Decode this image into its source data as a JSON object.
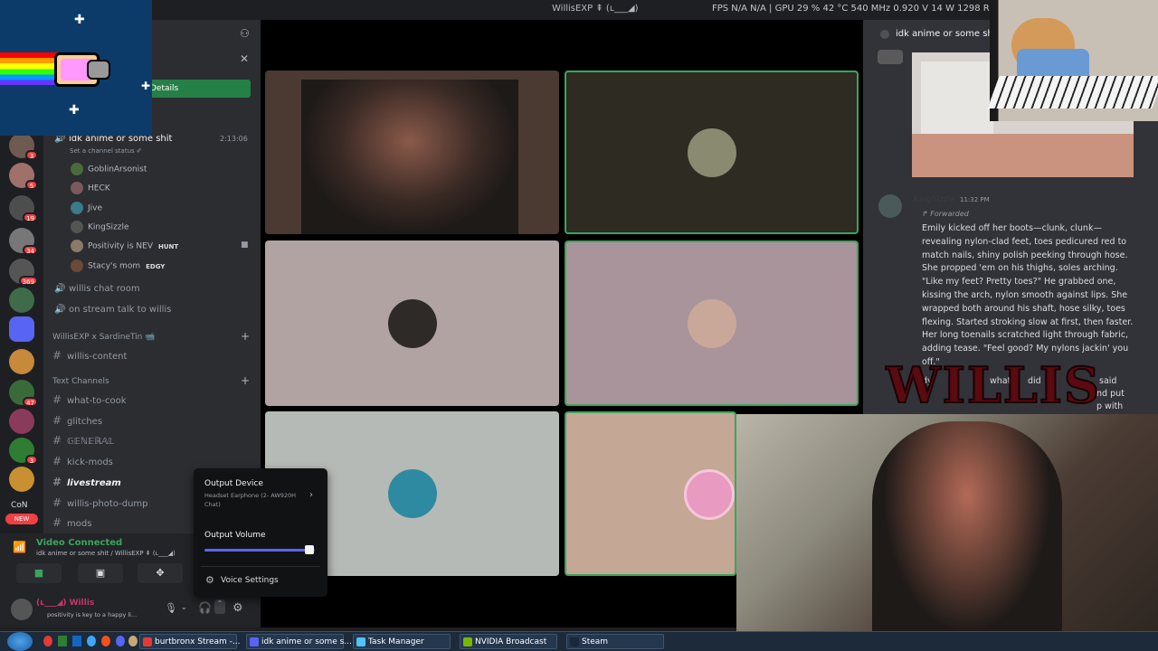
{
  "titlebar": {
    "title": "WillisEXP ⇞ (ʟ___◢)",
    "stats": "FPS  N/A  N/A  |  GPU  29 %  42 °C  540 MHz  0.920 V  14 W  1298 RPM"
  },
  "rail": {
    "badges": [
      "3",
      "5",
      "19",
      "34",
      "369",
      "47",
      "3"
    ],
    "con_label": "CoN",
    "new_label": "NEW"
  },
  "sidebar": {
    "details_button": "Details",
    "voice_channel": {
      "name": "idk anime or some shit",
      "timer": "2:13:06",
      "status_placeholder": "Set a channel status ✐",
      "members": [
        {
          "name": "GoblinArsonist",
          "tag": ""
        },
        {
          "name": "HECK",
          "tag": ""
        },
        {
          "name": "Jive",
          "tag": ""
        },
        {
          "name": "KingSizzle",
          "tag": ""
        },
        {
          "name": "Positivity is NEV",
          "tag": "HUNT"
        },
        {
          "name": "Stacy's mom",
          "tag": "EDGY"
        }
      ]
    },
    "voice_channels_extra": [
      "willis chat room",
      "on stream talk to willis"
    ],
    "category_1": "WillisEXP x SardineTin 📹",
    "category_1_channels": [
      "willis-content"
    ],
    "category_2": "Text Channels",
    "text_channels": [
      "what-to-cook",
      "glitches",
      "𝔾𝔼ℕ𝔼ℝ𝔸𝕃",
      "kick-mods",
      "livestream",
      "willis-photo-dump",
      "mods"
    ],
    "active_channel": "livestream"
  },
  "voice_status": {
    "title": "Video Connected",
    "subtitle": "idk anime or some shit / WillisEXP ⇞ (ʟ___◢)"
  },
  "user_panel": {
    "name": "(ʟ___◢) Willis",
    "status": "positivity is key to a happy li..."
  },
  "popup": {
    "output_device_label": "Output Device",
    "output_device_value": "Headset Earphone (2- AW920H Chat)",
    "output_volume_label": "Output Volume",
    "output_volume_level": 0.95,
    "voice_settings": "Voice Settings"
  },
  "chat": {
    "header": "idk anime or some shit",
    "author": "KingSizzle",
    "time": "11:32 PM",
    "forwarded": "Forwarded",
    "message": "Emily kicked off her boots—clunk, clunk—revealing nylon-clad feet, toes pedicured red to match nails, shiny polish peeking through hose. She propped 'em on his thighs, soles arching. \"Like my feet? Pretty toes?\" He grabbed one, kissing the arch, nylon smooth against lips. She wrapped both around his shaft, hose silky, toes flexing. Started stroking slow at first, then faster. Her long toenails scratched light through fabric, adding tease. \"Feel good? My nylons jackin' you off.\"",
    "partial_1": "dy",
    "partial_2": "what",
    "partial_3": "did",
    "partial_4": "said",
    "partial_5": "nd put",
    "partial_6": "p with"
  },
  "overlay": {
    "willis_logo": "WILLIS"
  },
  "taskbar": {
    "items": [
      "burtbronx Stream -...",
      "idk anime or some s...",
      "Task Manager",
      "NVIDIA Broadcast",
      "Steam"
    ]
  },
  "colors": {
    "discord_green": "#248046",
    "speaking_border": "#3ba55d",
    "badge_red": "#f23f43",
    "volume_blurple": "#5865f2"
  }
}
